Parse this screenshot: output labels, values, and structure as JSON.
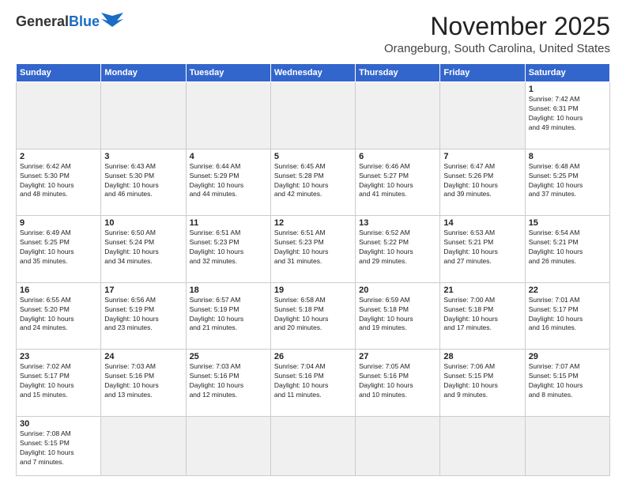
{
  "logo": {
    "general": "General",
    "blue": "Blue"
  },
  "header": {
    "month": "November 2025",
    "location": "Orangeburg, South Carolina, United States"
  },
  "weekdays": [
    "Sunday",
    "Monday",
    "Tuesday",
    "Wednesday",
    "Thursday",
    "Friday",
    "Saturday"
  ],
  "weeks": [
    [
      {
        "day": "",
        "info": ""
      },
      {
        "day": "",
        "info": ""
      },
      {
        "day": "",
        "info": ""
      },
      {
        "day": "",
        "info": ""
      },
      {
        "day": "",
        "info": ""
      },
      {
        "day": "",
        "info": ""
      },
      {
        "day": "1",
        "info": "Sunrise: 7:42 AM\nSunset: 6:31 PM\nDaylight: 10 hours\nand 49 minutes."
      }
    ],
    [
      {
        "day": "2",
        "info": "Sunrise: 6:42 AM\nSunset: 5:30 PM\nDaylight: 10 hours\nand 48 minutes."
      },
      {
        "day": "3",
        "info": "Sunrise: 6:43 AM\nSunset: 5:30 PM\nDaylight: 10 hours\nand 46 minutes."
      },
      {
        "day": "4",
        "info": "Sunrise: 6:44 AM\nSunset: 5:29 PM\nDaylight: 10 hours\nand 44 minutes."
      },
      {
        "day": "5",
        "info": "Sunrise: 6:45 AM\nSunset: 5:28 PM\nDaylight: 10 hours\nand 42 minutes."
      },
      {
        "day": "6",
        "info": "Sunrise: 6:46 AM\nSunset: 5:27 PM\nDaylight: 10 hours\nand 41 minutes."
      },
      {
        "day": "7",
        "info": "Sunrise: 6:47 AM\nSunset: 5:26 PM\nDaylight: 10 hours\nand 39 minutes."
      },
      {
        "day": "8",
        "info": "Sunrise: 6:48 AM\nSunset: 5:25 PM\nDaylight: 10 hours\nand 37 minutes."
      }
    ],
    [
      {
        "day": "9",
        "info": "Sunrise: 6:49 AM\nSunset: 5:25 PM\nDaylight: 10 hours\nand 35 minutes."
      },
      {
        "day": "10",
        "info": "Sunrise: 6:50 AM\nSunset: 5:24 PM\nDaylight: 10 hours\nand 34 minutes."
      },
      {
        "day": "11",
        "info": "Sunrise: 6:51 AM\nSunset: 5:23 PM\nDaylight: 10 hours\nand 32 minutes."
      },
      {
        "day": "12",
        "info": "Sunrise: 6:51 AM\nSunset: 5:23 PM\nDaylight: 10 hours\nand 31 minutes."
      },
      {
        "day": "13",
        "info": "Sunrise: 6:52 AM\nSunset: 5:22 PM\nDaylight: 10 hours\nand 29 minutes."
      },
      {
        "day": "14",
        "info": "Sunrise: 6:53 AM\nSunset: 5:21 PM\nDaylight: 10 hours\nand 27 minutes."
      },
      {
        "day": "15",
        "info": "Sunrise: 6:54 AM\nSunset: 5:21 PM\nDaylight: 10 hours\nand 26 minutes."
      }
    ],
    [
      {
        "day": "16",
        "info": "Sunrise: 6:55 AM\nSunset: 5:20 PM\nDaylight: 10 hours\nand 24 minutes."
      },
      {
        "day": "17",
        "info": "Sunrise: 6:56 AM\nSunset: 5:19 PM\nDaylight: 10 hours\nand 23 minutes."
      },
      {
        "day": "18",
        "info": "Sunrise: 6:57 AM\nSunset: 5:19 PM\nDaylight: 10 hours\nand 21 minutes."
      },
      {
        "day": "19",
        "info": "Sunrise: 6:58 AM\nSunset: 5:18 PM\nDaylight: 10 hours\nand 20 minutes."
      },
      {
        "day": "20",
        "info": "Sunrise: 6:59 AM\nSunset: 5:18 PM\nDaylight: 10 hours\nand 19 minutes."
      },
      {
        "day": "21",
        "info": "Sunrise: 7:00 AM\nSunset: 5:18 PM\nDaylight: 10 hours\nand 17 minutes."
      },
      {
        "day": "22",
        "info": "Sunrise: 7:01 AM\nSunset: 5:17 PM\nDaylight: 10 hours\nand 16 minutes."
      }
    ],
    [
      {
        "day": "23",
        "info": "Sunrise: 7:02 AM\nSunset: 5:17 PM\nDaylight: 10 hours\nand 15 minutes."
      },
      {
        "day": "24",
        "info": "Sunrise: 7:03 AM\nSunset: 5:16 PM\nDaylight: 10 hours\nand 13 minutes."
      },
      {
        "day": "25",
        "info": "Sunrise: 7:03 AM\nSunset: 5:16 PM\nDaylight: 10 hours\nand 12 minutes."
      },
      {
        "day": "26",
        "info": "Sunrise: 7:04 AM\nSunset: 5:16 PM\nDaylight: 10 hours\nand 11 minutes."
      },
      {
        "day": "27",
        "info": "Sunrise: 7:05 AM\nSunset: 5:16 PM\nDaylight: 10 hours\nand 10 minutes."
      },
      {
        "day": "28",
        "info": "Sunrise: 7:06 AM\nSunset: 5:15 PM\nDaylight: 10 hours\nand 9 minutes."
      },
      {
        "day": "29",
        "info": "Sunrise: 7:07 AM\nSunset: 5:15 PM\nDaylight: 10 hours\nand 8 minutes."
      }
    ],
    [
      {
        "day": "30",
        "info": "Sunrise: 7:08 AM\nSunset: 5:15 PM\nDaylight: 10 hours\nand 7 minutes."
      },
      {
        "day": "",
        "info": ""
      },
      {
        "day": "",
        "info": ""
      },
      {
        "day": "",
        "info": ""
      },
      {
        "day": "",
        "info": ""
      },
      {
        "day": "",
        "info": ""
      },
      {
        "day": "",
        "info": ""
      }
    ]
  ]
}
